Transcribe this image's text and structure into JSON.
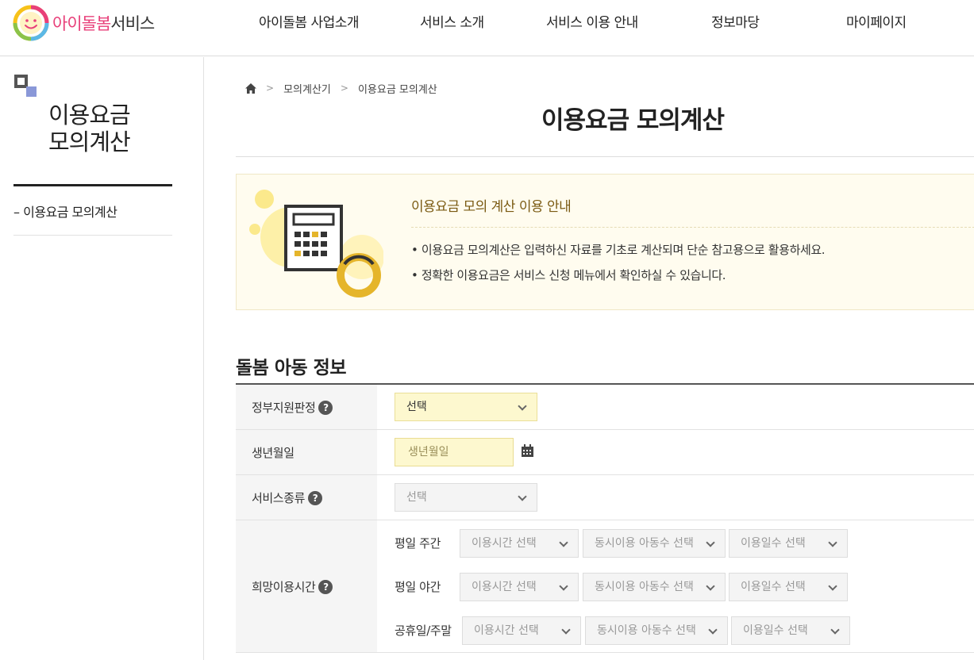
{
  "header": {
    "logo_text_pink": "아이돌봄",
    "logo_text_gray": "서비스",
    "nav": [
      {
        "label": "아이돌봄 사업소개"
      },
      {
        "label": "서비스 소개"
      },
      {
        "label": "서비스 이용 안내"
      },
      {
        "label": "정보마당"
      },
      {
        "label": "마이페이지"
      }
    ]
  },
  "sidebar": {
    "title_line1": "이용요금",
    "title_line2": "모의계산",
    "items": [
      {
        "label": "이용요금 모의계산",
        "bullet": "–"
      }
    ]
  },
  "breadcrumb": {
    "home_icon": "home-icon",
    "items": [
      "모의계산기",
      "이용요금 모의계산"
    ],
    "separator": ">"
  },
  "page_title": "이용요금 모의계산",
  "notice": {
    "icon": "calculator-icon",
    "title": "이용요금 모의 계산 이용 안내",
    "lines": [
      "• 이용요금 모의계산은 입력하신 자료를 기초로 계산되며 단순 참고용으로 활용하세요.",
      "• 정확한 이용요금은 서비스 신청 메뉴에서 확인하실 수 있습니다."
    ]
  },
  "section": {
    "title": "돌봄 아동 정보",
    "help_glyph": "?",
    "rows": {
      "gov_support": {
        "label": "정부지원판정",
        "select_value": "선택"
      },
      "birthdate": {
        "label": "생년월일",
        "placeholder": "생년월일",
        "icon": "calendar-icon"
      },
      "service_type": {
        "label": "서비스종류",
        "select_value": "선택"
      },
      "desired_time": {
        "label": "희망이용시간",
        "sub_rows": [
          {
            "label": "평일 주간",
            "time": "이용시간 선택",
            "children": "동시이용 아동수 선택",
            "days": "이용일수 선택"
          },
          {
            "label": "평일 야간",
            "time": "이용시간 선택",
            "children": "동시이용 아동수 선택",
            "days": "이용일수 선택"
          },
          {
            "label": "공휴일/주말",
            "time": "이용시간 선택",
            "children": "동시이용 아동수 선택",
            "days": "이용일수 선택"
          }
        ]
      }
    }
  },
  "colors": {
    "brand_pink": "#e8407a",
    "notice_bg": "#fffcef",
    "notice_title": "#7a5a12",
    "input_yellow": "#fdf8cf",
    "accent_yellow": "#e5b52b"
  }
}
